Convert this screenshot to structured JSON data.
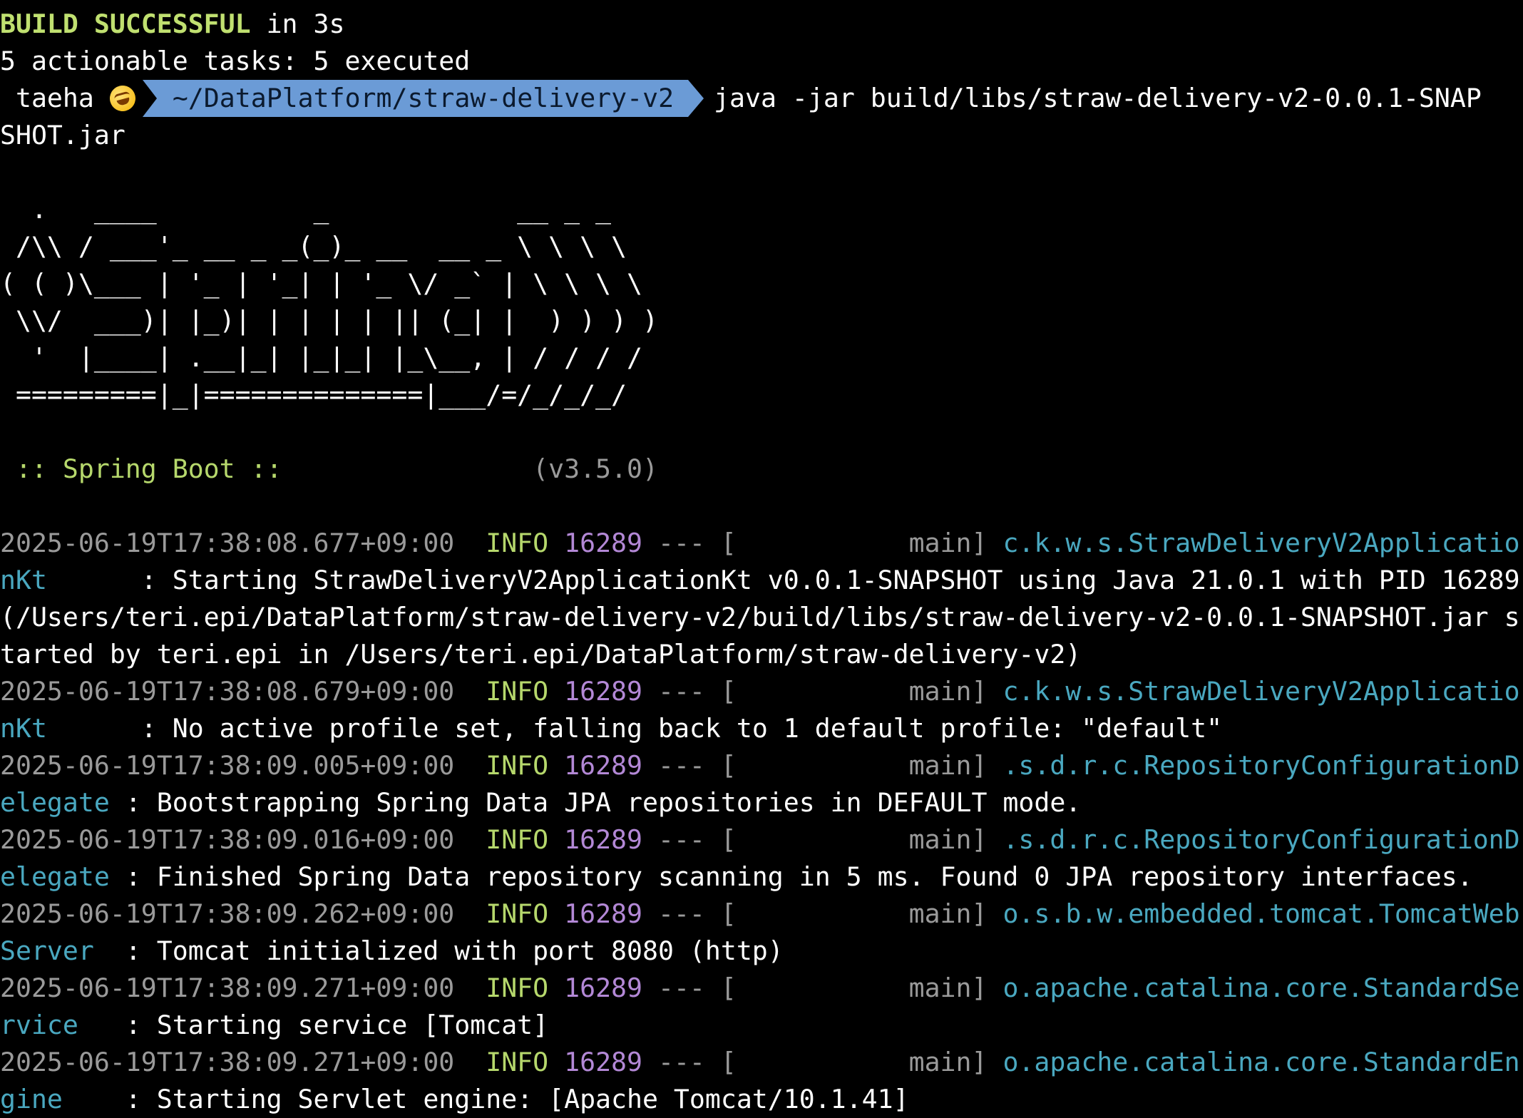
{
  "build": {
    "status": "BUILD SUCCESSFUL",
    "duration": " in 3s",
    "tasks": "5 actionable tasks: 5 executed"
  },
  "prompt": {
    "user": "taeha",
    "emoji": "rolling-on-floor-laughing-icon",
    "path": "~/DataPlatform/straw-delivery-v2",
    "command": "java -jar build/libs/straw-delivery-v2-0.0.1-SNAP",
    "command_wrap": "SHOT.jar"
  },
  "banner": {
    "lines": [
      "  .   ____          _            __ _ _",
      " /\\\\ / ___'_ __ _ _(_)_ __  __ _ \\ \\ \\ \\",
      "( ( )\\___ | '_ | '_| | '_ \\/ _` | \\ \\ \\ \\",
      " \\\\/  ___)| |_)| | | | | || (_| |  ) ) ) )",
      "  '  |____| .__|_| |_|_| |_\\__, | / / / /",
      " =========|_|==============|___/=/_/_/_/"
    ],
    "label": " :: Spring Boot :: ",
    "version": "(v3.5.0)"
  },
  "logs": [
    {
      "timestamp": "2025-06-19T17:38:08.677+09:00",
      "level": "INFO",
      "pid": "16289",
      "sep": "--- [",
      "thread": "main]",
      "logger_a": "c.k.w.s.StrawDeliveryV2Applicatio",
      "logger_b": "nKt     ",
      "message_lines": [
        ": Starting StrawDeliveryV2ApplicationKt v0.0.1-SNAPSHOT using Java 21.0.1 with PID 16289",
        "(/Users/teri.epi/DataPlatform/straw-delivery-v2/build/libs/straw-delivery-v2-0.0.1-SNAPSHOT.jar s",
        "tarted by teri.epi in /Users/teri.epi/DataPlatform/straw-delivery-v2)"
      ]
    },
    {
      "timestamp": "2025-06-19T17:38:08.679+09:00",
      "level": "INFO",
      "pid": "16289",
      "sep": "--- [",
      "thread": "main]",
      "logger_a": "c.k.w.s.StrawDeliveryV2Applicatio",
      "logger_b": "nKt     ",
      "message_lines": [
        ": No active profile set, falling back to 1 default profile: \"default\""
      ]
    },
    {
      "timestamp": "2025-06-19T17:38:09.005+09:00",
      "level": "INFO",
      "pid": "16289",
      "sep": "--- [",
      "thread": "main]",
      "logger_a": ".s.d.r.c.RepositoryConfigurationD",
      "logger_b": "elegate",
      "message_lines": [
        ": Bootstrapping Spring Data JPA repositories in DEFAULT mode."
      ]
    },
    {
      "timestamp": "2025-06-19T17:38:09.016+09:00",
      "level": "INFO",
      "pid": "16289",
      "sep": "--- [",
      "thread": "main]",
      "logger_a": ".s.d.r.c.RepositoryConfigurationD",
      "logger_b": "elegate",
      "message_lines": [
        ": Finished Spring Data repository scanning in 5 ms. Found 0 JPA repository interfaces."
      ]
    },
    {
      "timestamp": "2025-06-19T17:38:09.262+09:00",
      "level": "INFO",
      "pid": "16289",
      "sep": "--- [",
      "thread": "main]",
      "logger_a": "o.s.b.w.embedded.tomcat.TomcatWeb",
      "logger_b": "Server ",
      "message_lines": [
        ": Tomcat initialized with port 8080 (http)"
      ]
    },
    {
      "timestamp": "2025-06-19T17:38:09.271+09:00",
      "level": "INFO",
      "pid": "16289",
      "sep": "--- [",
      "thread": "main]",
      "logger_a": "o.apache.catalina.core.StandardSe",
      "logger_b": "rvice  ",
      "message_lines": [
        ": Starting service [Tomcat]"
      ]
    },
    {
      "timestamp": "2025-06-19T17:38:09.271+09:00",
      "level": "INFO",
      "pid": "16289",
      "sep": "--- [",
      "thread": "main]",
      "logger_a": "o.apache.catalina.core.StandardEn",
      "logger_b": "gine   ",
      "message_lines": [
        ": Starting Servlet engine: [Apache Tomcat/10.1.41]"
      ]
    }
  ],
  "colors": {
    "background": "#000000",
    "text": "#ffffff",
    "build_success": "#c0e070",
    "info_green": "#b6d86c",
    "timestamp_gray": "#9a9a9a",
    "pid_purple": "#b388d6",
    "logger_teal": "#4aa8c0",
    "prompt_path_bg": "#6b9bd6"
  }
}
